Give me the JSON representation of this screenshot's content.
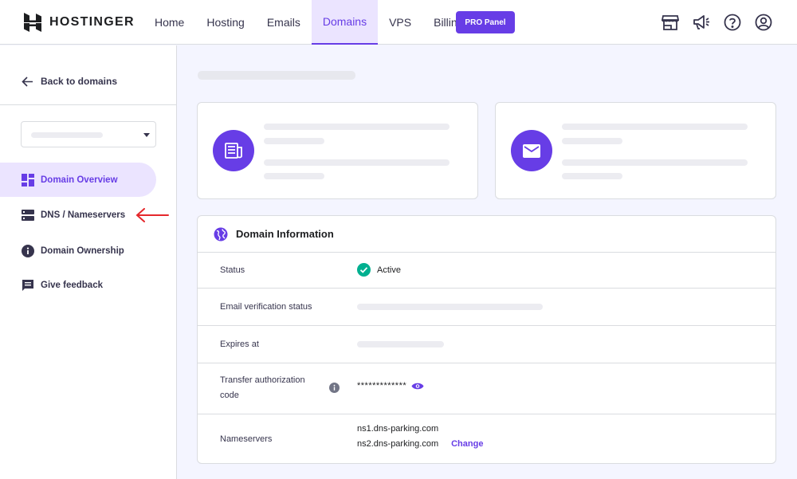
{
  "brand": {
    "name": "HOSTINGER",
    "accent": "#673de6",
    "annotation_color": "#e5282c"
  },
  "nav": {
    "items": [
      {
        "label": "Home"
      },
      {
        "label": "Hosting"
      },
      {
        "label": "Emails"
      },
      {
        "label": "Domains",
        "active": true
      },
      {
        "label": "VPS"
      },
      {
        "label": "Billing"
      }
    ],
    "pro_button": "PRO Panel",
    "icons": [
      "store-icon",
      "megaphone-icon",
      "help-icon",
      "account-icon"
    ]
  },
  "sidebar": {
    "back_label": "Back to domains",
    "items": [
      {
        "label": "Domain Overview",
        "icon": "dashboard-icon",
        "active": true
      },
      {
        "label": "DNS / Nameservers",
        "icon": "server-icon"
      },
      {
        "label": "Domain Ownership",
        "icon": "info-icon"
      },
      {
        "label": "Give feedback",
        "icon": "feedback-icon"
      }
    ]
  },
  "cards": [
    {
      "icon": "receipt-icon"
    },
    {
      "icon": "mail-icon"
    }
  ],
  "domain_info": {
    "title": "Domain Information",
    "rows": [
      {
        "label": "Status",
        "value": "Active",
        "status_icon": "check-circle-icon"
      },
      {
        "label": "Email verification status"
      },
      {
        "label": "Expires at"
      },
      {
        "label": "Transfer authorization code",
        "value": "*************"
      },
      {
        "label": "Nameservers",
        "ns1": "ns1.dns-parking.com",
        "ns2": "ns2.dns-parking.com",
        "action": "Change"
      }
    ]
  }
}
